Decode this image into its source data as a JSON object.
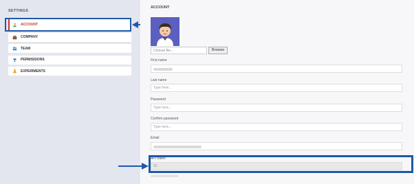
{
  "settings_title": "SETTINGS",
  "menu": [
    {
      "label": "ACCOUNT",
      "icon": "account-icon"
    },
    {
      "label": "COMPANY",
      "icon": "briefcase-icon"
    },
    {
      "label": "TEAM",
      "icon": "team-icon"
    },
    {
      "label": "PERMISSIONS",
      "icon": "permissions-icon"
    },
    {
      "label": "EXPERIMENTS",
      "icon": "experiments-icon"
    }
  ],
  "account": {
    "title": "ACCOUNT",
    "file_placeholder": "Choose file...",
    "browse_label": "Browse",
    "first_name_label": "First name",
    "last_name_label": "Last name",
    "last_name_placeholder": "Type here...",
    "password_label": "Password",
    "password_placeholder": "Type here...",
    "confirm_password_label": "Confirm password",
    "confirm_password_placeholder": "Type here...",
    "email_label": "Email",
    "api_token_label": "API token",
    "api_token_value": "02"
  },
  "colors": {
    "highlight": "#1e58a8",
    "active_menu": "#c0392b",
    "avatar_bg": "#5b5fbf"
  }
}
